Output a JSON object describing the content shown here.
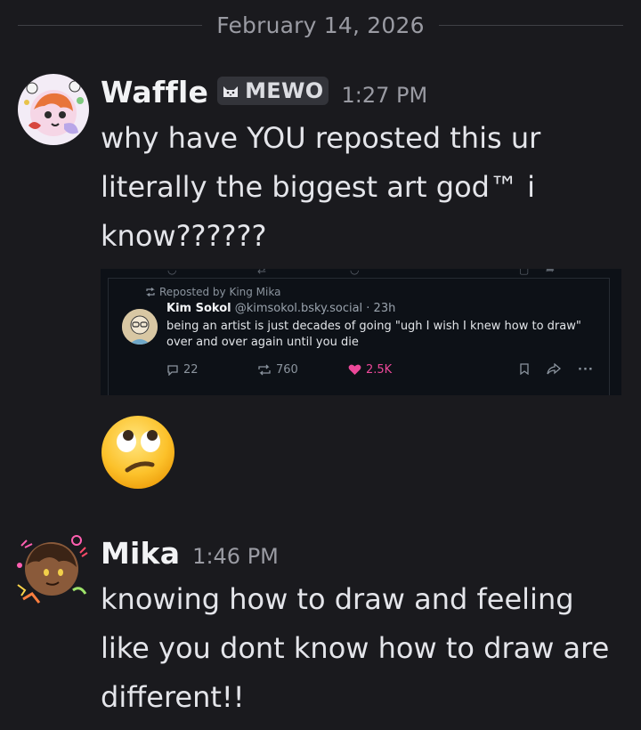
{
  "divider": {
    "date": "February 14, 2026"
  },
  "messages": [
    {
      "username": "Waffle",
      "tag": "MEWO",
      "time": "1:27 PM",
      "text_lines": [
        "why have YOU reposted this ur",
        "literally the biggest art god™ i",
        "know??????"
      ]
    },
    {
      "username": "Mika",
      "time": "1:46 PM",
      "text_lines": [
        "knowing how to draw and feeling",
        "like you dont know how to draw are",
        "different!!"
      ]
    }
  ],
  "embed": {
    "repost_label": "Reposted by King Mika",
    "author_name": "Kim Sokol",
    "author_handle": "@kimsokol.bsky.social · 23h",
    "post_lines": [
      "being an artist is just decades of going \"ugh I wish I knew how to draw\"",
      "over and over again until you die"
    ],
    "replies": "22",
    "reposts": "760",
    "likes": "2.5K",
    "like_color": "#ec4899"
  },
  "reaction_emoji": "face-with-rolling-eyes-icon"
}
